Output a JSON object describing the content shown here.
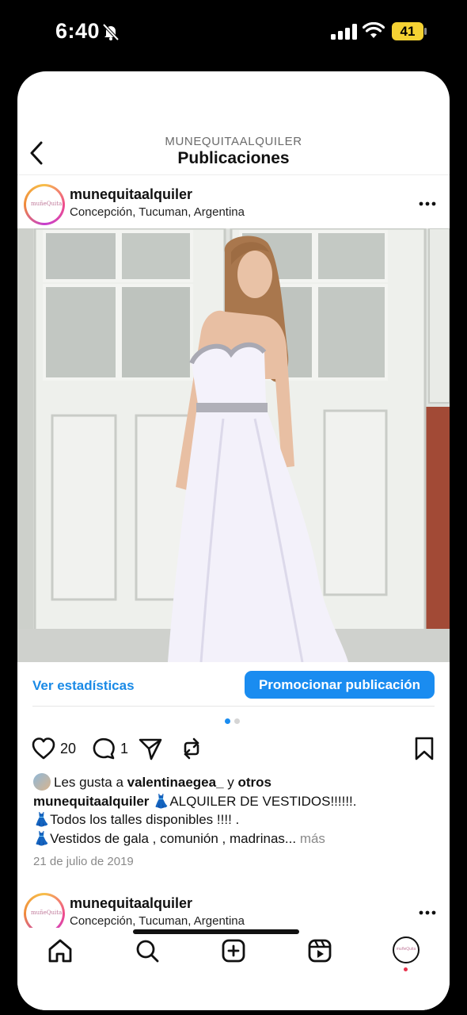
{
  "status_bar": {
    "time": "6:40",
    "battery": "41",
    "battery_color": "#f5d233"
  },
  "header": {
    "account": "MUNEQUITAALQUILER",
    "title": "Publicaciones"
  },
  "post": {
    "username": "munequitaalquiler",
    "location": "Concepción, Tucuman, Argentina",
    "avatar_text": "muñeQuita",
    "image": "photo of a woman in a white strapless sequined gown in front of white wooden doors",
    "stats_link": "Ver estadísticas",
    "promote_button": "Promocionar publicación",
    "carousel": {
      "count": 2,
      "active": 1
    },
    "likes": "20",
    "comments": "1",
    "liked_by_prefix": "Les gusta a ",
    "liked_by_user": "valentinaegea_",
    "liked_by_join": " y ",
    "liked_by_others": "otros",
    "caption_user": "munequitaalquiler",
    "caption_line1": "ALQUILER DE VESTIDOS!!!!!!.",
    "caption_line2": "Todos los talles disponibles !!!! .",
    "caption_line3": "Vestidos de gala , comunión , madrinas...",
    "caption_emoji": "👗",
    "more_label": "más",
    "date": "21 de julio de 2019"
  },
  "next_post": {
    "username": "munequitaalquiler",
    "location": "Concepción, Tucuman, Argentina"
  },
  "nav": {
    "items": [
      "home-icon",
      "search-icon",
      "create-icon",
      "reels-icon",
      "profile-avatar"
    ]
  },
  "colors": {
    "accent": "#1a8cf0",
    "link": "#1a8ae6",
    "notification": "#e8314b"
  }
}
